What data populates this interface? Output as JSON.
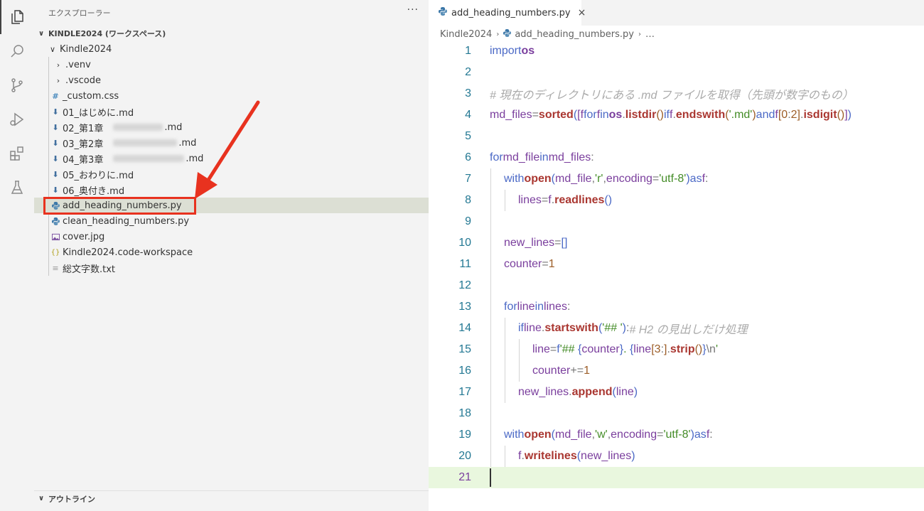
{
  "activity_bar": {
    "icons": [
      "explorer-icon",
      "search-icon",
      "source-control-icon",
      "run-debug-icon",
      "extensions-icon",
      "testing-icon"
    ]
  },
  "sidebar": {
    "title": "エクスプローラー",
    "more": "···",
    "workspace": "KINDLE2024 (ワークスペース)",
    "root_folder": "Kindle2024",
    "items": [
      {
        "label": ".venv",
        "icon": "chevron-right"
      },
      {
        "label": ".vscode",
        "icon": "chevron-right"
      },
      {
        "label": "_custom.css",
        "icon": "hash"
      },
      {
        "label": "01_はじめに.md",
        "icon": "markdown-download"
      },
      {
        "label": "02_第1章",
        "suffix": ".md",
        "icon": "markdown-download"
      },
      {
        "label": "03_第2章",
        "suffix": ".md",
        "icon": "markdown-download"
      },
      {
        "label": "04_第3章",
        "suffix": ".md",
        "icon": "markdown-download"
      },
      {
        "label": "05_おわりに.md",
        "icon": "markdown-download"
      },
      {
        "label": "06_奥付き.md",
        "icon": "markdown-download"
      },
      {
        "label": "add_heading_numbers.py",
        "icon": "python"
      },
      {
        "label": "clean_heading_numbers.py",
        "icon": "python"
      },
      {
        "label": "cover.jpg",
        "icon": "image"
      },
      {
        "label": "Kindle2024.code-workspace",
        "icon": "braces"
      },
      {
        "label": "総文字数.txt",
        "icon": "text"
      }
    ],
    "outline": "アウトライン"
  },
  "editor": {
    "tab_label": "add_heading_numbers.py",
    "tab_close": "×",
    "breadcrumb": [
      "Kindle2024",
      "add_heading_numbers.py",
      "…"
    ],
    "line_numbers": [
      "1",
      "2",
      "3",
      "4",
      "5",
      "6",
      "7",
      "8",
      "9",
      "10",
      "11",
      "12",
      "13",
      "14",
      "15",
      "16",
      "17",
      "18",
      "19",
      "20",
      "21"
    ]
  },
  "colors": {
    "highlight": "#e8321f",
    "selected_row": "#dcdfd4",
    "current_line": "#e9f7de"
  }
}
